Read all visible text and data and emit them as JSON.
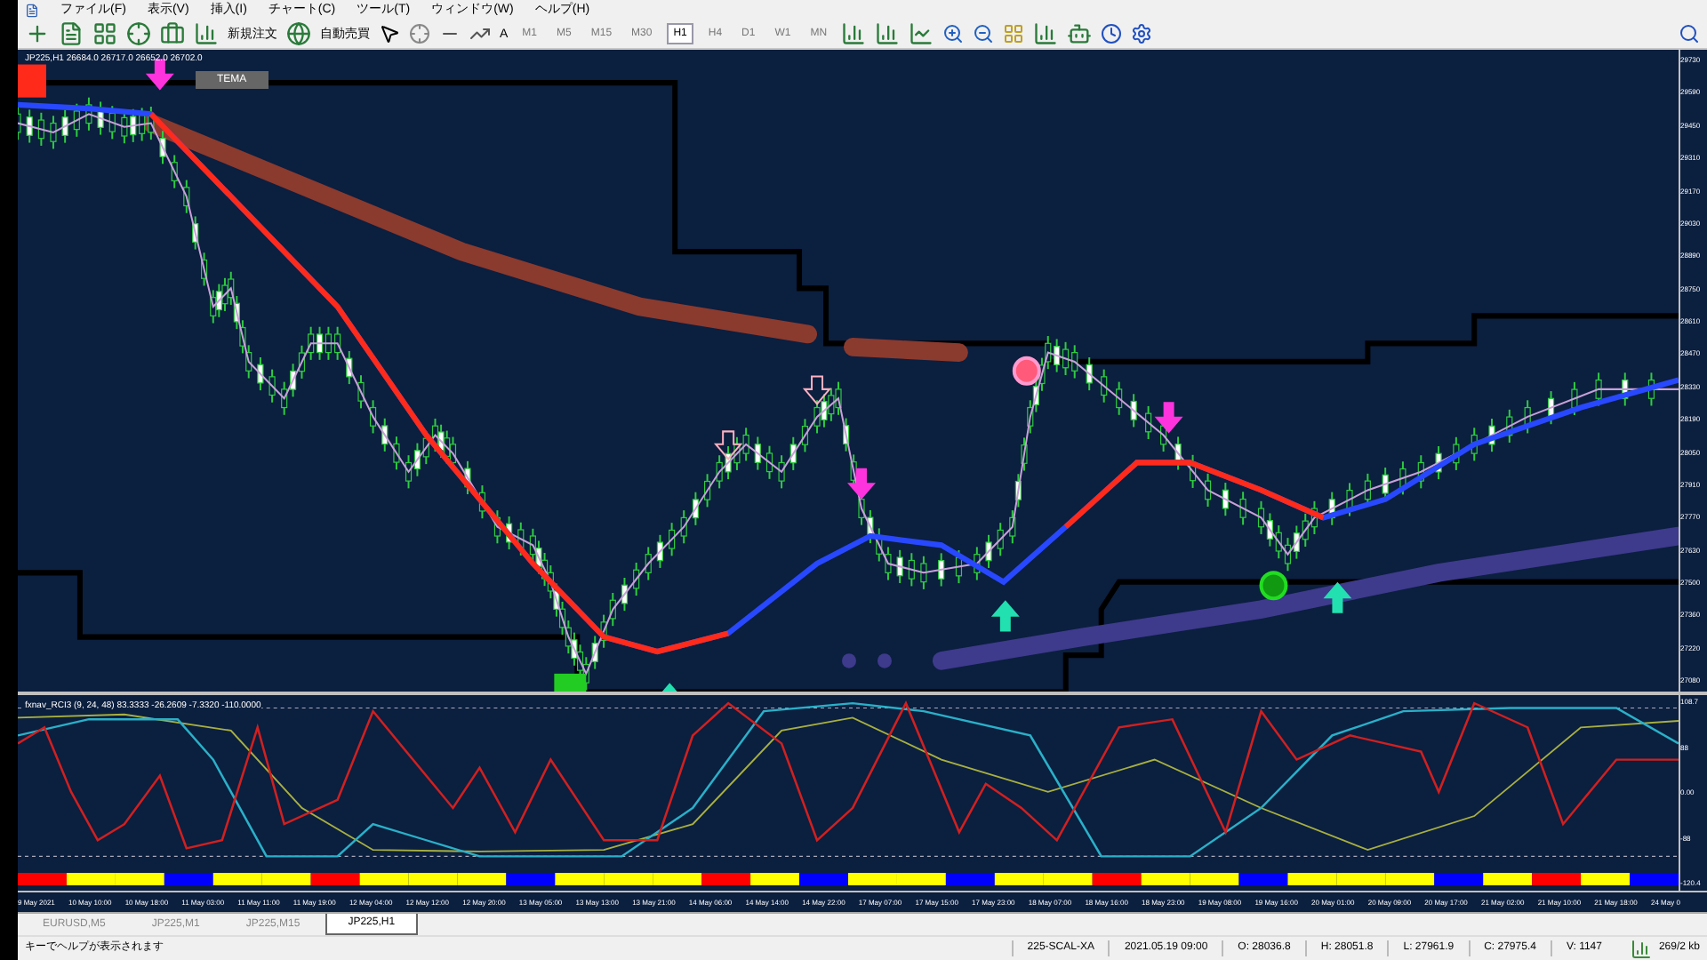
{
  "menu": [
    "ファイル(F)",
    "表示(V)",
    "挿入(I)",
    "チャート(C)",
    "ツール(T)",
    "ウィンドウ(W)",
    "ヘルプ(H)"
  ],
  "toolbar": {
    "new_order": "新規注文",
    "auto_trading": "自動売買",
    "text_tool": "A",
    "timeframes": [
      {
        "label": "M1",
        "selected": false
      },
      {
        "label": "M5",
        "selected": false
      },
      {
        "label": "M15",
        "selected": false
      },
      {
        "label": "M30",
        "selected": false
      },
      {
        "label": "H1",
        "selected": true
      },
      {
        "label": "H4",
        "selected": false
      },
      {
        "label": "D1",
        "selected": false
      },
      {
        "label": "W1",
        "selected": false
      },
      {
        "label": "MN",
        "selected": false
      }
    ]
  },
  "chart": {
    "header": "JP225,H1  26684.0 26717.0 26652.0 26702.0",
    "tema_label": "TEMA",
    "price_axis": [
      "29730",
      "29590",
      "29450",
      "29310",
      "29170",
      "29030",
      "28890",
      "28750",
      "28610",
      "28470",
      "28330",
      "28190",
      "28050",
      "27910",
      "27770",
      "27630",
      "27500",
      "27360",
      "27220",
      "27080"
    ],
    "indicator": {
      "header": "fxnav_RCI3 (9, 24, 48) 83.3333 -26.2609 -7.3320 -110.0000",
      "axis": [
        "108.7",
        "88",
        "0.00",
        "-88",
        "-120.4"
      ]
    },
    "time_axis": [
      "9 May 2021",
      "10 May 10:00",
      "10 May 18:00",
      "11 May 03:00",
      "11 May 11:00",
      "11 May 19:00",
      "12 May 04:00",
      "12 May 12:00",
      "12 May 20:00",
      "13 May 05:00",
      "13 May 13:00",
      "13 May 21:00",
      "14 May 06:00",
      "14 May 14:00",
      "14 May 22:00",
      "17 May 07:00",
      "17 May 15:00",
      "17 May 23:00",
      "18 May 07:00",
      "18 May 16:00",
      "18 May 23:00",
      "19 May 08:00",
      "19 May 16:00",
      "20 May 01:00",
      "20 May 09:00",
      "20 May 17:00",
      "21 May 02:00",
      "21 May 10:00",
      "21 May 18:00",
      "24 May 0"
    ]
  },
  "chart_tabs": [
    {
      "label": "EURUSD,M5",
      "selected": false
    },
    {
      "label": "JP225,M1",
      "selected": false
    },
    {
      "label": "JP225,M15",
      "selected": false
    },
    {
      "label": "JP225,H1",
      "selected": true
    }
  ],
  "status_bar": {
    "help": "キーでヘルプが表示されます",
    "profile": "225-SCAL-XA",
    "time": "2021.05.19 09:00",
    "open": "O: 28036.8",
    "high": "H: 28051.8",
    "low": "L: 27961.9",
    "close": "C: 27975.4",
    "volume": "V: 1147",
    "traffic": "269/2 kb"
  }
}
